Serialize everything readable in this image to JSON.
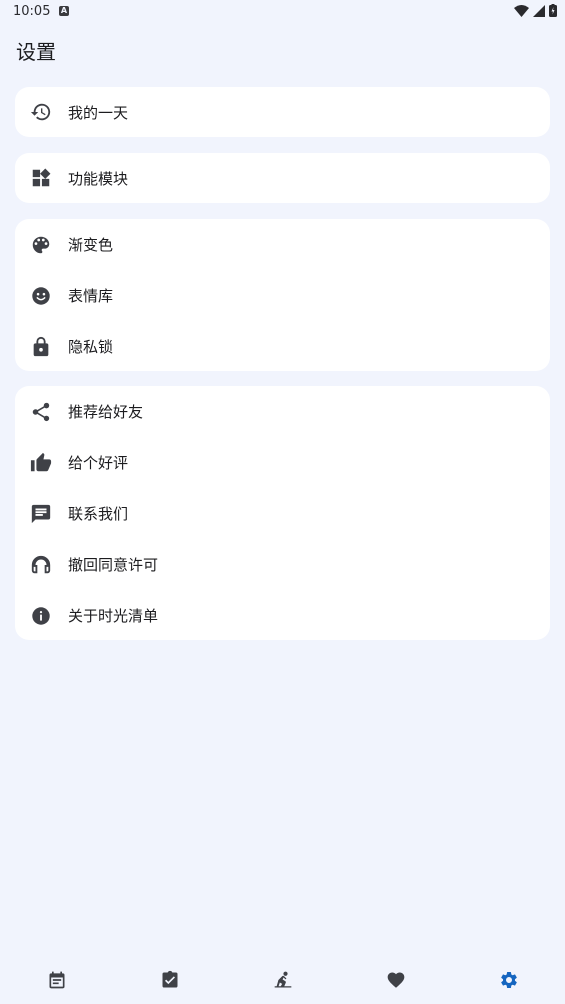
{
  "status_bar": {
    "time": "10:05",
    "a_badge": "A"
  },
  "page": {
    "title": "设置"
  },
  "groups": [
    {
      "items": [
        {
          "label": "我的一天",
          "icon": "history-icon"
        }
      ]
    },
    {
      "items": [
        {
          "label": "功能模块",
          "icon": "widgets-icon"
        }
      ]
    },
    {
      "items": [
        {
          "label": "渐变色",
          "icon": "palette-icon"
        },
        {
          "label": "表情库",
          "icon": "emoji-icon"
        },
        {
          "label": "隐私锁",
          "icon": "lock-icon"
        }
      ]
    },
    {
      "items": [
        {
          "label": "推荐给好友",
          "icon": "share-icon"
        },
        {
          "label": "给个好评",
          "icon": "thumb-up-icon"
        },
        {
          "label": "联系我们",
          "icon": "chat-icon"
        },
        {
          "label": "撤回同意许可",
          "icon": "revoke-icon"
        },
        {
          "label": "关于时光清单",
          "icon": "info-icon"
        }
      ]
    }
  ],
  "bottom_nav": [
    {
      "icon": "calendar-icon",
      "active": false
    },
    {
      "icon": "task-check-icon",
      "active": false
    },
    {
      "icon": "person-reading-icon",
      "active": false
    },
    {
      "icon": "heart-icon",
      "active": false
    },
    {
      "icon": "settings-gear-icon",
      "active": true
    }
  ],
  "colors": {
    "background": "#f1f4fd",
    "card": "#ffffff",
    "icon": "#3f4147",
    "accent": "#1565c0"
  }
}
